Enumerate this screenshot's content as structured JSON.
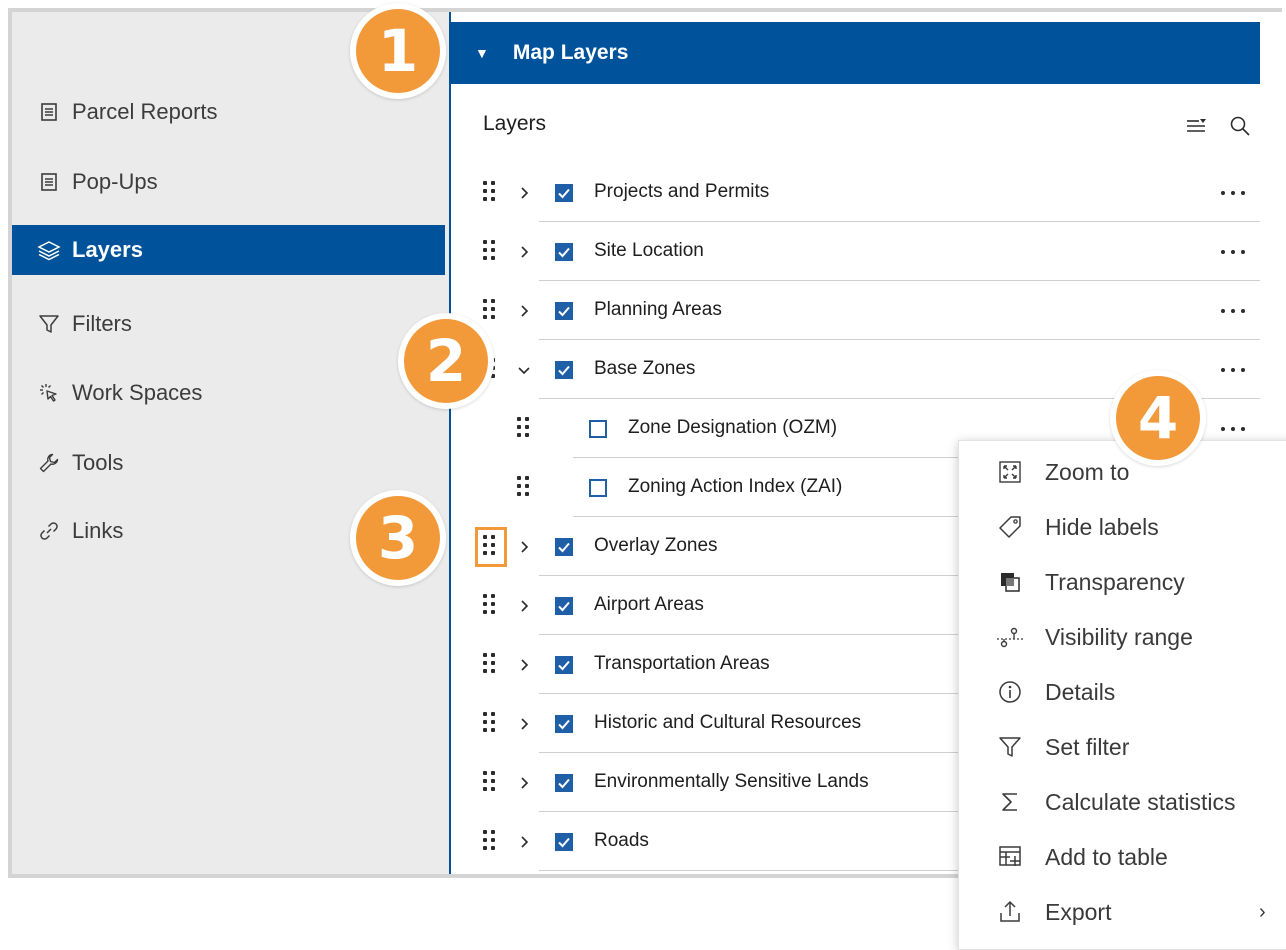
{
  "sidebar": {
    "items": [
      {
        "label": "Parcel Reports",
        "icon": "document-icon",
        "active": false
      },
      {
        "label": "Pop-Ups",
        "icon": "document-icon",
        "active": false
      },
      {
        "label": "Layers",
        "icon": "layers-icon",
        "active": true
      },
      {
        "label": "Filters",
        "icon": "filter-icon",
        "active": false
      },
      {
        "label": "Work Spaces",
        "icon": "cursor-click-icon",
        "active": false
      },
      {
        "label": "Tools",
        "icon": "wrench-icon",
        "active": false
      },
      {
        "label": "Links",
        "icon": "link-icon",
        "active": false
      }
    ]
  },
  "panel": {
    "title": "Map Layers",
    "layers_heading": "Layers",
    "layers": [
      {
        "label": "Projects and Permits",
        "checked": true,
        "expanded": false,
        "child": false
      },
      {
        "label": "Site Location",
        "checked": true,
        "expanded": false,
        "child": false
      },
      {
        "label": "Planning Areas",
        "checked": true,
        "expanded": false,
        "child": false
      },
      {
        "label": "Base Zones",
        "checked": true,
        "expanded": true,
        "child": false
      },
      {
        "label": "Zone Designation (OZM)",
        "checked": false,
        "expanded": false,
        "child": true
      },
      {
        "label": "Zoning Action Index (ZAI)",
        "checked": false,
        "expanded": false,
        "child": true
      },
      {
        "label": "Overlay Zones",
        "checked": true,
        "expanded": false,
        "child": false
      },
      {
        "label": "Airport Areas",
        "checked": true,
        "expanded": false,
        "child": false
      },
      {
        "label": "Transportation Areas",
        "checked": true,
        "expanded": false,
        "child": false
      },
      {
        "label": "Historic and Cultural Resources",
        "checked": true,
        "expanded": false,
        "child": false
      },
      {
        "label": "Environmentally Sensitive Lands",
        "checked": true,
        "expanded": false,
        "child": false
      },
      {
        "label": "Roads",
        "checked": true,
        "expanded": false,
        "child": false
      }
    ]
  },
  "context_menu": {
    "items": [
      {
        "label": "Zoom to",
        "icon": "zoom-to-icon"
      },
      {
        "label": "Hide labels",
        "icon": "tag-icon"
      },
      {
        "label": "Transparency",
        "icon": "transparency-icon"
      },
      {
        "label": "Visibility range",
        "icon": "visibility-range-icon"
      },
      {
        "label": "Details",
        "icon": "info-icon"
      },
      {
        "label": "Set filter",
        "icon": "filter-icon"
      },
      {
        "label": "Calculate statistics",
        "icon": "sigma-icon"
      },
      {
        "label": "Add to table",
        "icon": "add-table-icon"
      },
      {
        "label": "Export",
        "icon": "export-icon",
        "submenu_arrow": "›"
      }
    ]
  },
  "callouts": [
    "1",
    "2",
    "3",
    "4"
  ],
  "colors": {
    "header_blue": "#00539b",
    "checkbox_blue": "#1f5fa8",
    "badge_orange": "#f29a3a",
    "sidebar_bg": "#ebebeb"
  }
}
